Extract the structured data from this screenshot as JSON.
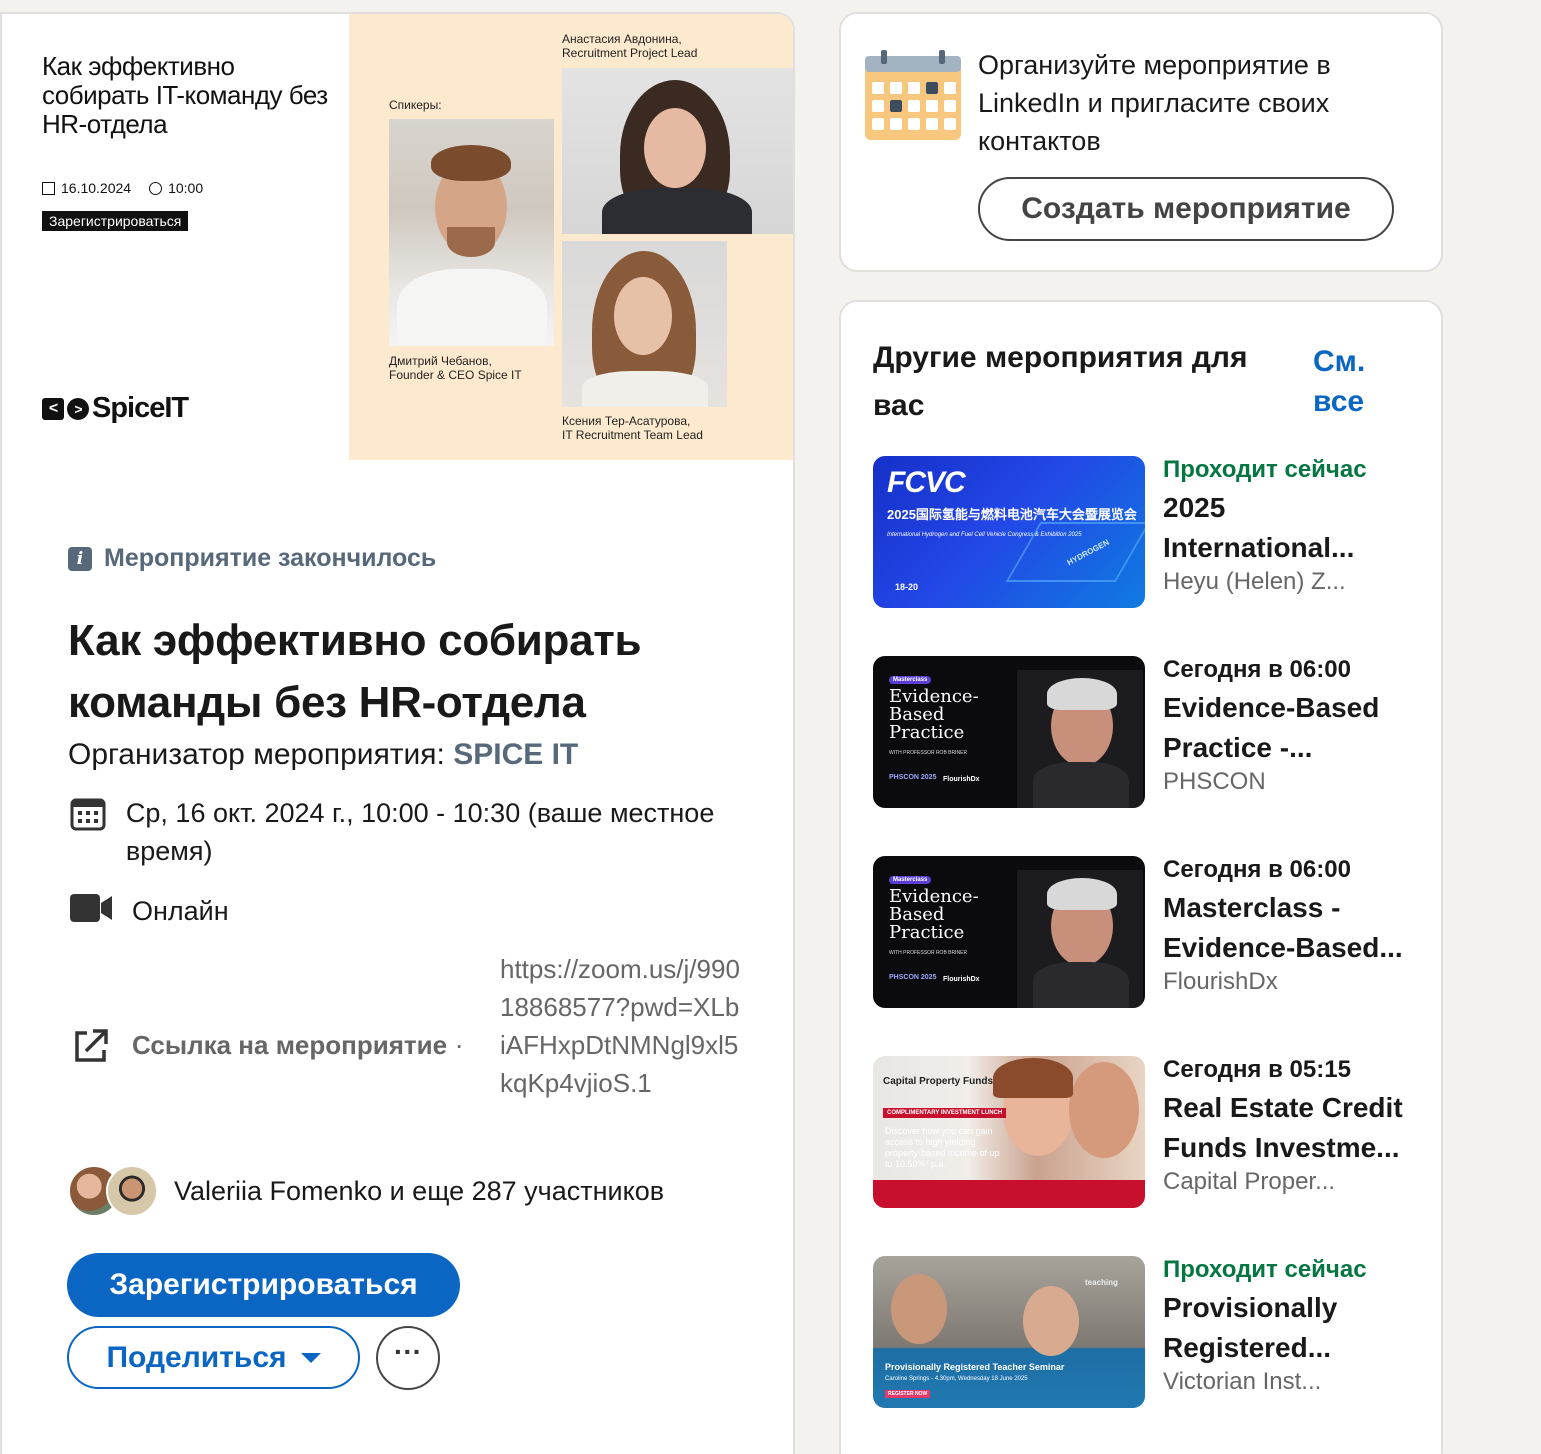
{
  "banner": {
    "title": "Как эффективно собирать IT-команду без HR-отдела",
    "date": "16.10.2024",
    "time": "10:00",
    "register": "Зарегистрироваться",
    "logo": "SpiceIT",
    "speakers_label": "Спикеры:",
    "speaker1": "Анастасия Авдонина,\nRecruitment Project Lead",
    "speaker2": "Дмитрий Чебанов,\nFounder & CEO Spice IT",
    "speaker3": "Ксения Тер-Асатурова,\nIT Recruitment Team Lead"
  },
  "event": {
    "status": "Мероприятие закончилось",
    "title": "Как эффективно собирать команды без HR-отдела",
    "organizer_label": "Организатор мероприятия: ",
    "organizer": "SPICE IT",
    "datetime": "Ср, 16 окт. 2024 г., 10:00 - 10:30 (ваше местное время)",
    "format": "Онлайн",
    "link_label": "Ссылка на мероприятие",
    "link_sep": "·",
    "link_url": "https://zoom.us/j/99018868577?pwd=XLbiAFHxpDtNMNgl9xl5kqKp4vjioS.1",
    "attendees": "Valeriia Fomenko и еще 287 участников",
    "register_btn": "Зарегистрироваться",
    "share_btn": "Поделиться",
    "more_btn": "···"
  },
  "create": {
    "text": "Организуйте мероприятие в LinkedIn и пригласите своих контактов",
    "button": "Создать мероприятие"
  },
  "others": {
    "title": "Другие мероприятия для вас",
    "see_all": "См. все",
    "items": [
      {
        "when": "Проходит сейчас",
        "name": "2025 International...",
        "org": "Heyu (Helen) Z..."
      },
      {
        "when": "Сегодня в 06:00",
        "name": "Evidence-Based Practice -...",
        "org": "PHSCON"
      },
      {
        "when": "Сегодня в 06:00",
        "name": "Masterclass - Evidence-Based...",
        "org": "FlourishDx"
      },
      {
        "when": "Сегодня в 05:15",
        "name": "Real Estate Credit Funds Investme...",
        "org": "Capital Proper..."
      },
      {
        "when": "Проходит сейчас",
        "name": "Provisionally Registered...",
        "org": "Victorian Inst..."
      }
    ],
    "thumbs": {
      "t1_a": "FCVC",
      "t1_b": "2025国际氢能与燃料电池汽车大会暨展览会",
      "t1_c": "International Hydrogen and Fuel Cell Vehicle Congress & Exhibition 2025",
      "t1_d": "18-20",
      "t1_e": "HYDROGEN",
      "t2_a": "Masterclass",
      "t2_b": "Evidence-\nBased\nPractice",
      "t2_c": "WITH PROFESSOR ROB BRINER",
      "t2_d": "PHSCON 2025",
      "t2_e": "FlourishDx",
      "t4_a": "Capital Property Funds",
      "t4_b": "COMPLIMENTARY INVESTMENT LUNCH",
      "t4_c": "Discover how you can gain access to high yielding property-based income of up to 10.50%¹ p.a.",
      "t5_a": "teaching",
      "t5_b": "Provisionally Registered Teacher Seminar",
      "t5_c": "Caroline Springs - 4.30pm, Wednesday 18 June 2025",
      "t5_d": "REGISTER NOW"
    }
  },
  "colors": {
    "accent": "#0a66c2",
    "live": "#057642",
    "muted": "#56687a"
  }
}
